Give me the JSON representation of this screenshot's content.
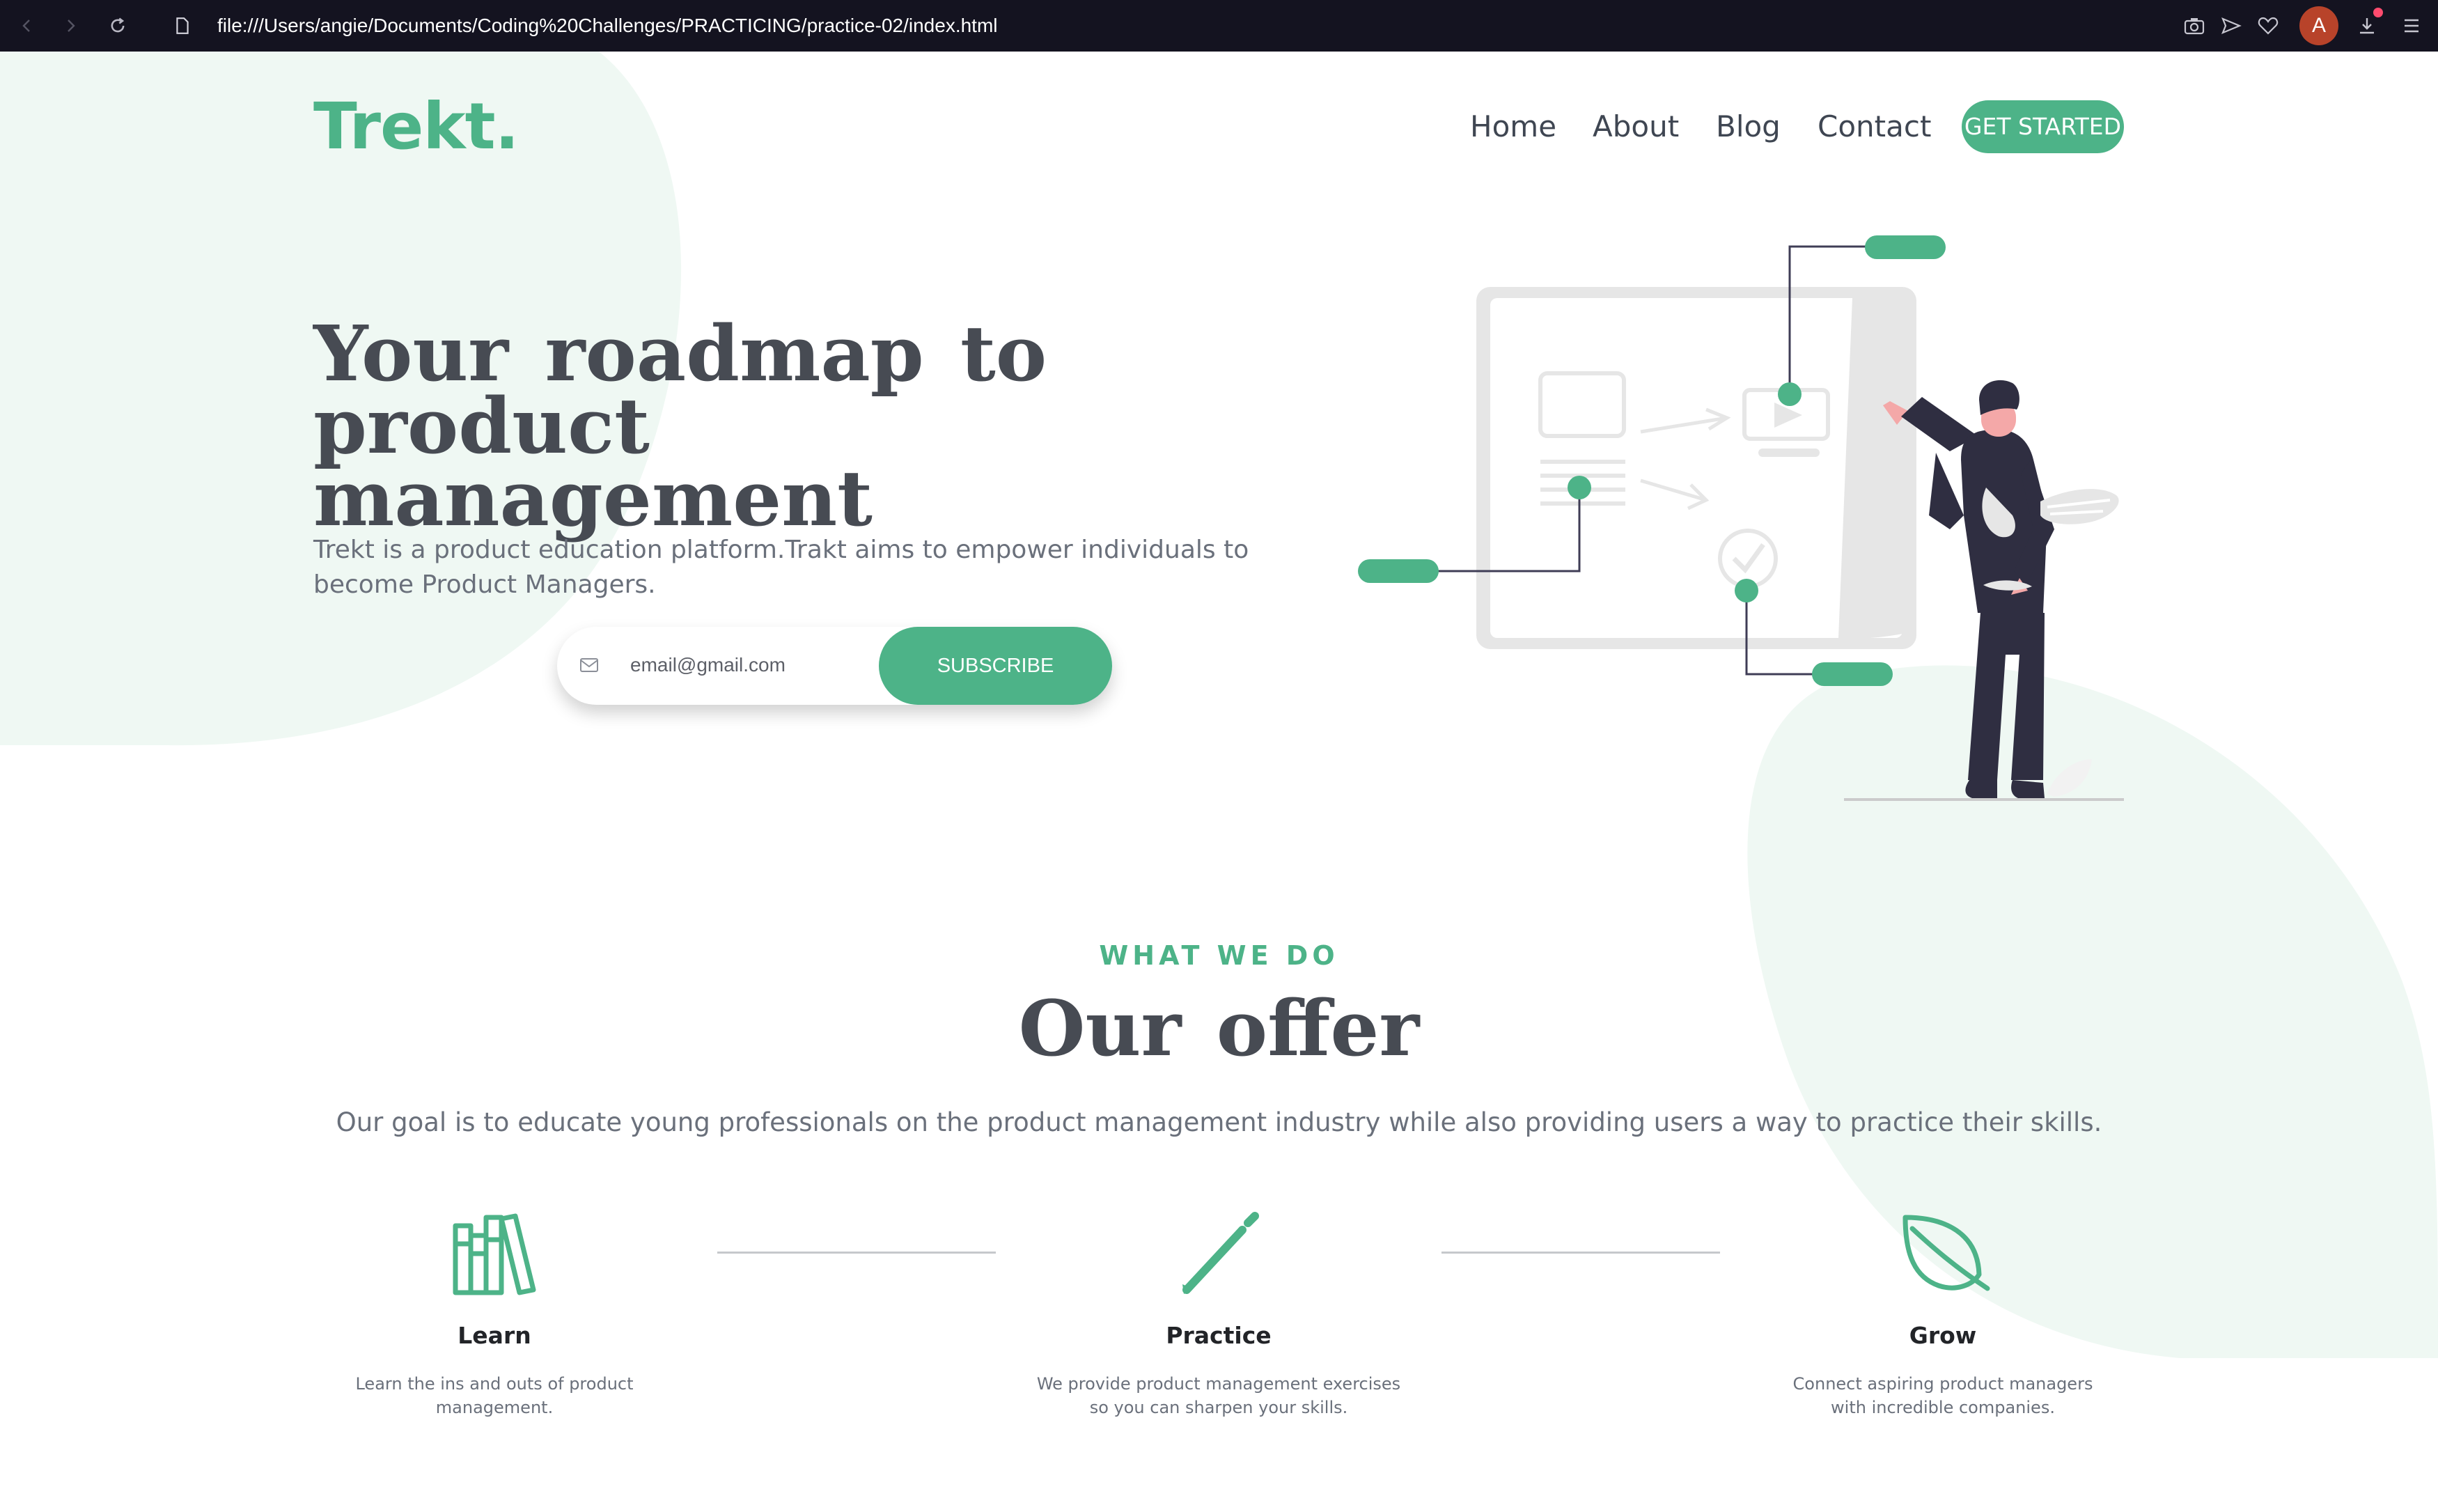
{
  "browser": {
    "url": "file:///Users/angie/Documents/Coding%20Challenges/PRACTICING/practice-02/index.html",
    "avatar_letter": "A",
    "icons": [
      "back-icon",
      "forward-icon",
      "reload-icon",
      "page-icon",
      "camera-icon",
      "send-icon",
      "heart-icon",
      "download-icon",
      "menu-icon"
    ]
  },
  "header": {
    "logo": "Trekt.",
    "nav": [
      "Home",
      "About",
      "Blog",
      "Contact"
    ],
    "cta": "GET STARTED"
  },
  "hero": {
    "title_line1": "Your roadmap to product",
    "title_line2": "management",
    "subtitle": "Trekt is a product education platform.Trakt aims to empower individuals to become Product Managers.",
    "email_placeholder": "email@gmail.com",
    "email_icon": "mail-icon",
    "subscribe": "SUBSCRIBE"
  },
  "offer": {
    "eyebrow": "WHAT WE DO",
    "title": "Our offer",
    "description": "Our goal is to educate young professionals on the product management industry while also providing users a way to practice their skills.",
    "features": [
      {
        "icon": "books-icon",
        "title": "Learn",
        "description": "Learn the ins and outs of product management."
      },
      {
        "icon": "pencil-icon",
        "title": "Practice",
        "description": "We provide product management exercises so you can sharpen your skills."
      },
      {
        "icon": "leaf-icon",
        "title": "Grow",
        "description": "Connect aspiring product managers with incredible companies."
      }
    ]
  },
  "colors": {
    "accent": "#4db388",
    "blob": "#eff8f3",
    "heading": "#474b53",
    "body": "#6a707b",
    "chrome": "#141320"
  }
}
